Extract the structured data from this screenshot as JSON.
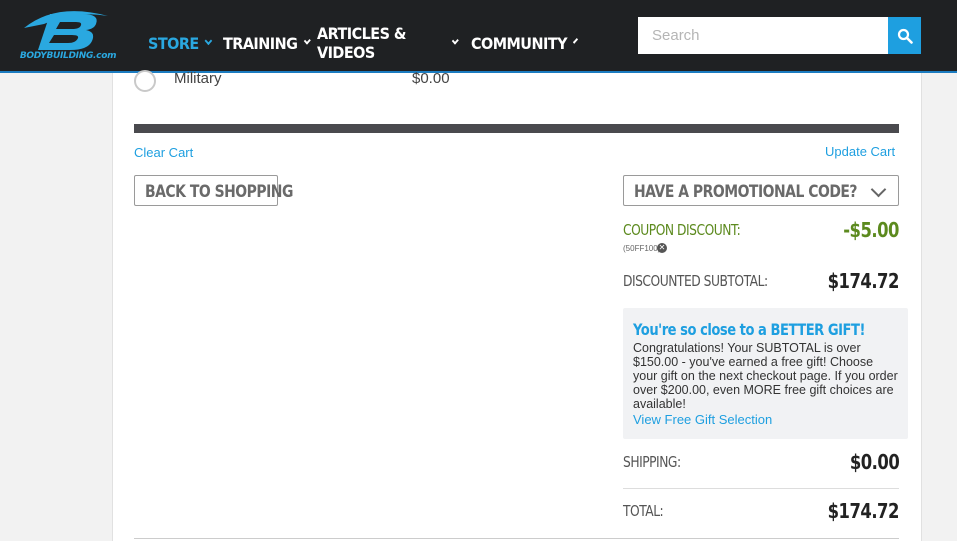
{
  "header": {
    "logo_text": "BODYBUILDING.com",
    "nav": [
      {
        "label": "STORE",
        "active": true
      },
      {
        "label": "TRAINING",
        "active": false
      },
      {
        "label": "ARTICLES & VIDEOS",
        "active": false
      },
      {
        "label": "COMMUNITY",
        "active": false
      }
    ],
    "search": {
      "placeholder": "Search",
      "value": ""
    },
    "colors": {
      "bar": "#1f2123",
      "accent": "#1e9fe0"
    }
  },
  "shipping_option": {
    "label": "Military",
    "price": "$0.00",
    "selected": false
  },
  "cart_actions": {
    "clear": "Clear Cart",
    "update": "Update Cart"
  },
  "back_button": "BACK TO SHOPPING",
  "promo": {
    "label": "HAVE A PROMOTIONAL CODE?",
    "icon": "chevron-down-icon"
  },
  "summary": {
    "coupon_label": "COUPON DISCOUNT:",
    "coupon_code": "(50FF100)",
    "coupon_value": "-$5.00",
    "subtotal_label": "DISCOUNTED SUBTOTAL:",
    "subtotal_value": "$174.72",
    "shipping_label": "SHIPPING:",
    "shipping_value": "$0.00",
    "total_label": "TOTAL:",
    "total_value": "$174.72",
    "discount_color": "#5c8a1e"
  },
  "gift": {
    "title": "You're so close to a BETTER GIFT!",
    "body": "Congratulations! Your SUBTOTAL is over $150.00 - you've earned a free gift! Choose your gift on the next checkout page. If you order over $200.00, even MORE free gift choices are available!",
    "link": "View Free Gift Selection"
  }
}
